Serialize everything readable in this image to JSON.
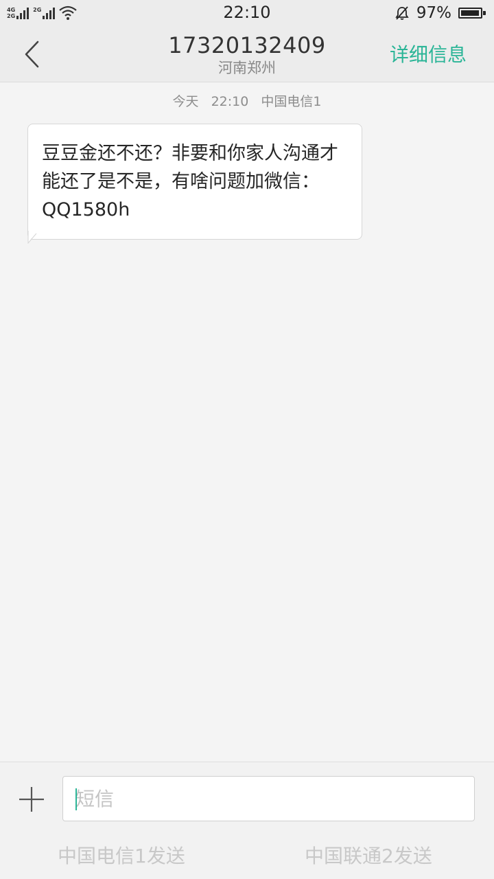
{
  "status_bar": {
    "network_top": "4G",
    "network_bottom": "2G",
    "network2": "2G",
    "time": "22:10",
    "battery": "97%",
    "icons": [
      "signal-icon",
      "wifi-icon",
      "bell-off-icon",
      "battery-icon"
    ],
    "battery_level": 0.97
  },
  "header": {
    "contact_number": "17320132409",
    "contact_location": "河南郑州",
    "details_label": "详细信息",
    "accent_color": "#2bb597"
  },
  "conversation": {
    "date_label": "今天",
    "time": "22:10",
    "sim_label": "中国电信1",
    "messages": [
      {
        "text": "豆豆金还不还？非要和你家人沟通才能还了是不是，有啥问题加微信：QQ1580h",
        "direction": "incoming"
      }
    ]
  },
  "compose": {
    "placeholder": "短信",
    "send_sim1": "中国电信1发送",
    "send_sim2": "中国联通2发送"
  }
}
